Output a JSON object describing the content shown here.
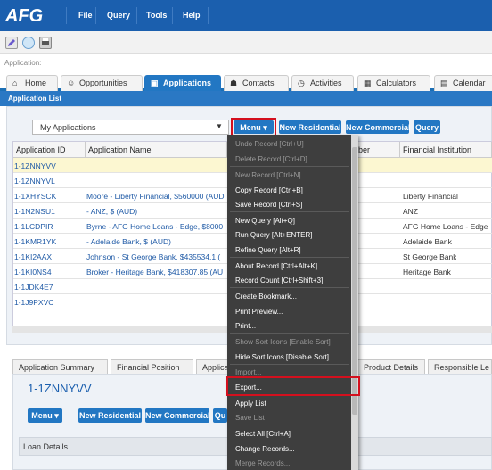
{
  "app": {
    "logo": "AFG",
    "menu": [
      "File",
      "Query",
      "Tools",
      "Help"
    ]
  },
  "breadcrumb": "Application:",
  "tabs": [
    {
      "label": "Home",
      "icon": "home-icon"
    },
    {
      "label": "Opportunities",
      "icon": "people-icon"
    },
    {
      "label": "Applications",
      "icon": "form-icon",
      "active": true
    },
    {
      "label": "Contacts",
      "icon": "contacts-icon"
    },
    {
      "label": "Activities",
      "icon": "alarm-icon"
    },
    {
      "label": "Calculators",
      "icon": "calculator-icon"
    },
    {
      "label": "Calendar",
      "icon": "calendar-icon"
    }
  ],
  "list": {
    "title": "Application List",
    "view_select": "My Applications",
    "buttons": {
      "menu": "Menu",
      "new_residential": "New Residential",
      "new_commercial": "New Commercial",
      "query": "Query"
    },
    "columns": {
      "app_id": "Application ID",
      "app_name": "Application Name",
      "number_partial": "ber",
      "financial_institution": "Financial Institution"
    },
    "rows": [
      {
        "id": "1-1ZNNYVV",
        "name": "",
        "fi": ""
      },
      {
        "id": "1-1ZNNYVL",
        "name": "",
        "fi": ""
      },
      {
        "id": "1-1XHYSCK",
        "name": "Moore - Liberty Financial, $560000 (AUD",
        "fi": "Liberty Financial"
      },
      {
        "id": "1-1N2NSU1",
        "name": " - ANZ, $ (AUD)",
        "fi": "ANZ"
      },
      {
        "id": "1-1LCDPIR",
        "name": "Byrne - AFG Home Loans - Edge, $8000",
        "fi": "AFG Home Loans - Edge"
      },
      {
        "id": "1-1KMR1YK",
        "name": " - Adelaide Bank, $ (AUD)",
        "fi": "Adelaide Bank"
      },
      {
        "id": "1-1KI2AAX",
        "name": "Johnson - St George Bank, $435534.1 (",
        "fi": "St George Bank"
      },
      {
        "id": "1-1KI0NS4",
        "name": "Broker - Heritage Bank, $418307.85 (AU",
        "fi": "Heritage Bank"
      },
      {
        "id": "1-1JDK4E7",
        "name": "",
        "fi": ""
      },
      {
        "id": "1-1J9PXVC",
        "name": "",
        "fi": ""
      }
    ]
  },
  "detail_tabs": [
    "Application Summary",
    "Financial Position",
    "Applica",
    "Product Details",
    "Responsible Le"
  ],
  "detail": {
    "record_id": "1-1ZNNYVV",
    "buttons": {
      "menu": "Menu",
      "new_residential": "New Residential",
      "new_commercial": "New Commercial",
      "query_partial": "Qu"
    },
    "section": "Loan Details"
  },
  "dropdown": [
    {
      "label": "Undo Record [Ctrl+U]",
      "enabled": false
    },
    {
      "label": "Delete Record [Ctrl+D]",
      "enabled": false
    },
    {
      "label": "New Record [Ctrl+N]",
      "enabled": false
    },
    {
      "label": "Copy Record [Ctrl+B]",
      "enabled": true
    },
    {
      "label": "Save Record [Ctrl+S]",
      "enabled": true
    },
    {
      "label": "New Query [Alt+Q]",
      "enabled": true
    },
    {
      "label": "Run Query [Alt+ENTER]",
      "enabled": true
    },
    {
      "label": "Refine Query [Alt+R]",
      "enabled": true
    },
    {
      "label": "About Record [Ctrl+Alt+K]",
      "enabled": true
    },
    {
      "label": "Record Count [Ctrl+Shift+3]",
      "enabled": true
    },
    {
      "label": "Create Bookmark...",
      "enabled": true
    },
    {
      "label": "Print Preview...",
      "enabled": true
    },
    {
      "label": "Print...",
      "enabled": true
    },
    {
      "label": "Show Sort Icons [Enable Sort]",
      "enabled": false
    },
    {
      "label": "Hide Sort Icons [Disable Sort]",
      "enabled": true
    },
    {
      "label": "Import...",
      "enabled": false
    },
    {
      "label": "Export...",
      "enabled": true,
      "highlighted": true
    },
    {
      "label": "Apply List",
      "enabled": true
    },
    {
      "label": "Save List",
      "enabled": false
    },
    {
      "label": "Select All [Ctrl+A]",
      "enabled": true
    },
    {
      "label": "Change Records...",
      "enabled": true
    },
    {
      "label": "Merge Records...",
      "enabled": false
    }
  ],
  "colors": {
    "brand": "#1b5fae",
    "accent": "#2277c3",
    "highlight": "#d4101e",
    "menu_bg": "#3e3e3e"
  }
}
